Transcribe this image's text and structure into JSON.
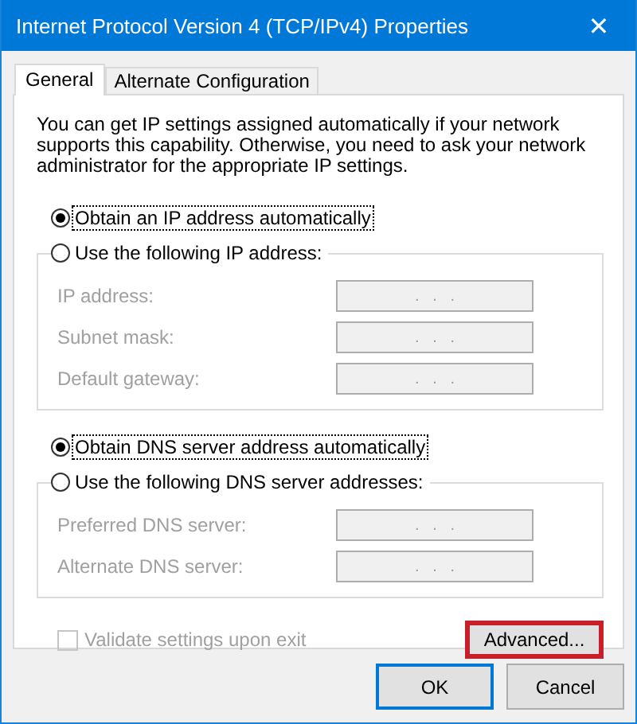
{
  "window": {
    "title": "Internet Protocol Version 4 (TCP/IPv4) Properties",
    "close": "✕"
  },
  "tabs": [
    {
      "label": "General",
      "selected": true
    },
    {
      "label": "Alternate Configuration",
      "selected": false
    }
  ],
  "description": "You can get IP settings assigned automatically if your network supports this capability. Otherwise, you need to ask your network administrator for the appropriate IP settings.",
  "sections": [
    {
      "auto_option": {
        "label": "Obtain an IP address automatically",
        "selected": true
      },
      "manual_option": {
        "label": "Use the following IP address:",
        "selected": false
      },
      "fields": [
        {
          "label": "IP address:",
          "value": ".   .   .",
          "disabled": true
        },
        {
          "label": "Subnet mask:",
          "value": ".   .   .",
          "disabled": true
        },
        {
          "label": "Default gateway:",
          "value": ".   .   .",
          "disabled": true
        }
      ]
    },
    {
      "auto_option": {
        "label": "Obtain DNS server address automatically",
        "selected": true
      },
      "manual_option": {
        "label": "Use the following DNS server addresses:",
        "selected": false
      },
      "fields": [
        {
          "label": "Preferred DNS server:",
          "value": ".   .   .",
          "disabled": true
        },
        {
          "label": "Alternate DNS server:",
          "value": ".   .   .",
          "disabled": true
        }
      ]
    }
  ],
  "validate": {
    "label": "Validate settings upon exit",
    "checked": false,
    "disabled": true
  },
  "advanced_button": {
    "label": "Advanced...",
    "highlighted": true
  },
  "buttons": [
    {
      "label": "OK",
      "default": true
    },
    {
      "label": "Cancel",
      "default": false
    }
  ]
}
